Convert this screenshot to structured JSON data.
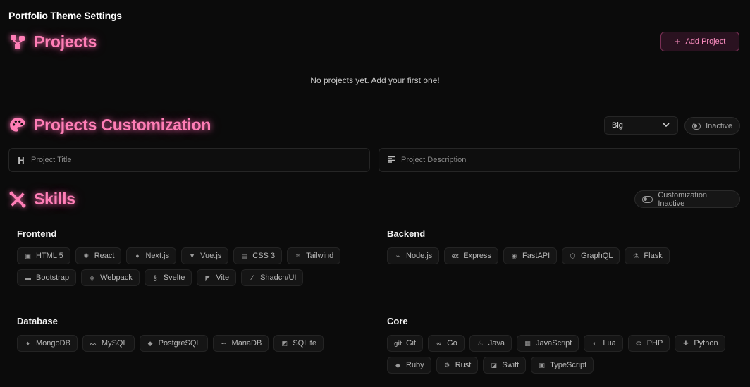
{
  "page": {
    "title": "Portfolio Theme Settings"
  },
  "projects": {
    "title": "Projects",
    "add_button": "Add Project",
    "empty_message": "No projects yet. Add your first one!"
  },
  "customization": {
    "title": "Projects Customization",
    "size_select": "Big",
    "status": "Inactive",
    "title_placeholder": "Project Title",
    "description_placeholder": "Project Description"
  },
  "skills": {
    "title": "Skills",
    "status": "Customization Inactive",
    "groups": [
      {
        "name": "Frontend",
        "items": [
          "HTML 5",
          "React",
          "Next.js",
          "Vue.js",
          "CSS 3",
          "Tailwind",
          "Bootstrap",
          "Webpack",
          "Svelte",
          "Vite",
          "Shadcn/UI"
        ]
      },
      {
        "name": "Backend",
        "items": [
          "Node.js",
          "Express",
          "FastAPI",
          "GraphQL",
          "Flask"
        ]
      },
      {
        "name": "Database",
        "items": [
          "MongoDB",
          "MySQL",
          "PostgreSQL",
          "MariaDB",
          "SQLite"
        ]
      },
      {
        "name": "Core",
        "items": [
          "Git",
          "Go",
          "Java",
          "JavaScript",
          "Lua",
          "PHP",
          "Python",
          "Ruby",
          "Rust",
          "Swift",
          "TypeScript"
        ]
      }
    ]
  },
  "colors": {
    "accent": "#ff7eb6",
    "background": "#0b0b0b"
  }
}
